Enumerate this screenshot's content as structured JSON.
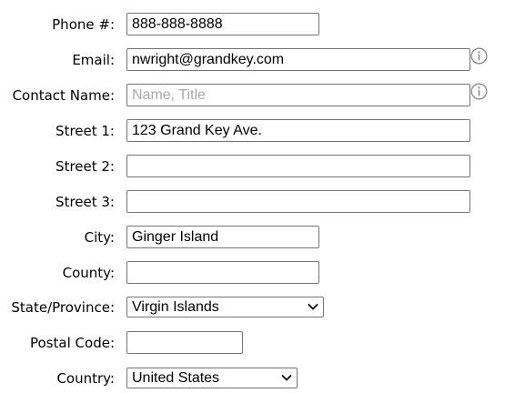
{
  "form": {
    "phone": {
      "label": "Phone #:",
      "value": "888-888-8888"
    },
    "email": {
      "label": "Email:",
      "value": "nwright@grandkey.com"
    },
    "contact": {
      "label": "Contact Name:",
      "value": "",
      "placeholder": "Name, Title"
    },
    "street1": {
      "label": "Street 1:",
      "value": "123 Grand Key Ave."
    },
    "street2": {
      "label": "Street 2:",
      "value": ""
    },
    "street3": {
      "label": "Street 3:",
      "value": ""
    },
    "city": {
      "label": "City:",
      "value": "Ginger Island"
    },
    "county": {
      "label": "County:",
      "value": ""
    },
    "state": {
      "label": "State/Province:",
      "selected": "Virgin Islands"
    },
    "postal": {
      "label": "Postal Code:",
      "value": ""
    },
    "country": {
      "label": "Country:",
      "selected": "United States"
    }
  },
  "icons": {
    "email_info": "info-icon",
    "contact_info": "info-icon",
    "dropdown": "chevron-down-icon"
  }
}
